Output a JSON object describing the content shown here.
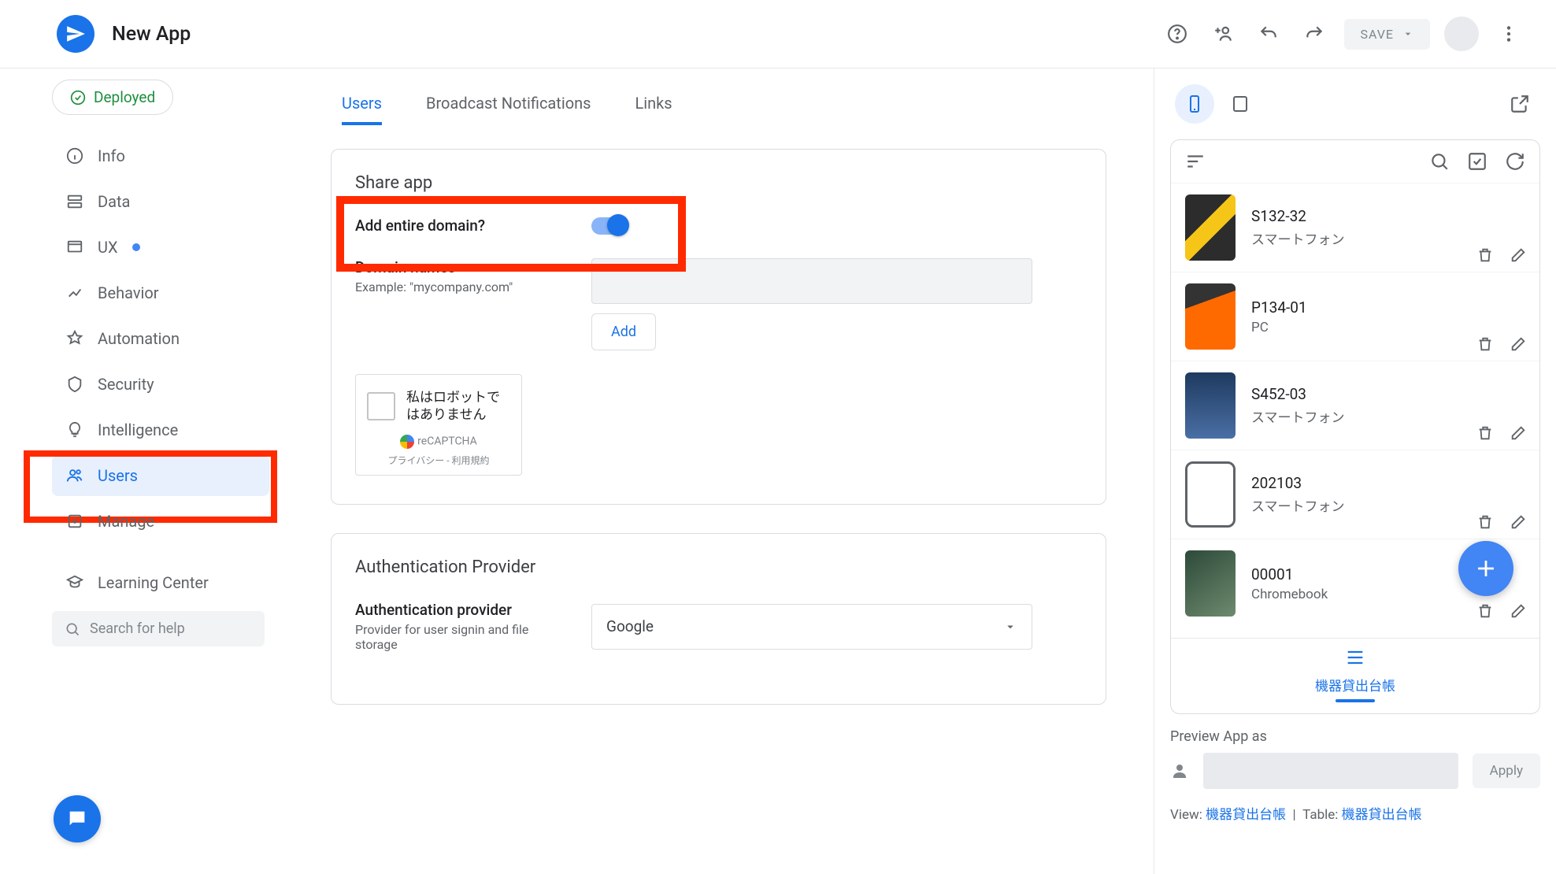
{
  "header": {
    "app_name": "New App",
    "save_label": "SAVE"
  },
  "sidebar": {
    "deployed": "Deployed",
    "items": {
      "info": "Info",
      "data": "Data",
      "ux": "UX",
      "behavior": "Behavior",
      "automation": "Automation",
      "security": "Security",
      "intelligence": "Intelligence",
      "users": "Users",
      "manage": "Manage",
      "learning": "Learning Center"
    },
    "search_placeholder": "Search for help"
  },
  "tabs": {
    "users": "Users",
    "broadcast": "Broadcast Notifications",
    "links": "Links"
  },
  "share": {
    "title": "Share app",
    "add_domain_label": "Add entire domain?",
    "domain_names_label": "Domain names",
    "domain_names_example": "Example: \"mycompany.com\"",
    "add_btn": "Add",
    "recaptcha_label": "私はロボットではありません",
    "recaptcha_badge": "reCAPTCHA",
    "recaptcha_terms": "プライバシー - 利用規約"
  },
  "auth": {
    "title": "Authentication Provider",
    "label": "Authentication provider",
    "sub": "Provider for user signin and file storage",
    "value": "Google"
  },
  "preview": {
    "items": [
      {
        "code": "S132-32",
        "type": "スマートフォン",
        "thumb": "th-phone"
      },
      {
        "code": "P134-01",
        "type": "PC",
        "thumb": "th-laptop"
      },
      {
        "code": "S452-03",
        "type": "スマートフォン",
        "thumb": "th-iphone"
      },
      {
        "code": "202103",
        "type": "スマートフォン",
        "thumb": "th-outline"
      },
      {
        "code": "00001",
        "type": "Chromebook",
        "thumb": "th-chrome"
      }
    ],
    "bottom_tab": "機器貸出台帳",
    "preview_as_label": "Preview App as",
    "apply": "Apply",
    "view_label": "View:",
    "view_value": "機器貸出台帳",
    "table_label": "Table:",
    "table_value": "機器貸出台帳"
  }
}
